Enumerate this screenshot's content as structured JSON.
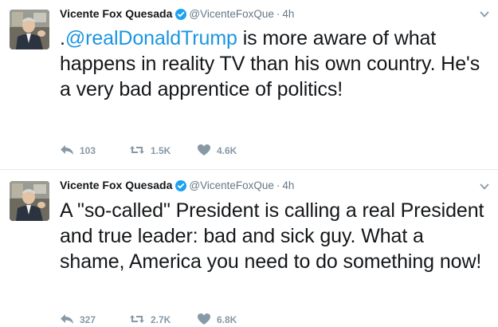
{
  "colors": {
    "link": "#1b95e0",
    "secondary_text": "#657786",
    "action_icon": "#8899a6",
    "verified_badge": "#1da1f2",
    "divider": "#e1e8ed"
  },
  "tweets": [
    {
      "author": {
        "display_name": "Vicente Fox Quesada",
        "verified": true,
        "handle": "@VicenteFoxQue",
        "avatar": "avatar-photo"
      },
      "separator": "·",
      "time": "4h",
      "text_prefix": ".",
      "mention": "@realDonaldTrump",
      "text_body": " is more aware of what happens in reality TV than his own country. He's a very bad apprentice of politics!",
      "actions": {
        "replies": "103",
        "retweets": "1.5K",
        "likes": "4.6K"
      },
      "icons": [
        "verified-badge-icon",
        "chevron-down-icon",
        "reply-icon",
        "retweet-icon",
        "heart-icon"
      ]
    },
    {
      "author": {
        "display_name": "Vicente Fox Quesada",
        "verified": true,
        "handle": "@VicenteFoxQue",
        "avatar": "avatar-photo"
      },
      "separator": "·",
      "time": "4h",
      "text_body": "A \"so-called\" President is calling a real President and true leader: bad and sick guy. What a shame, America you need to do something now!",
      "actions": {
        "replies": "327",
        "retweets": "2.7K",
        "likes": "6.8K"
      },
      "icons": [
        "verified-badge-icon",
        "chevron-down-icon",
        "reply-icon",
        "retweet-icon",
        "heart-icon"
      ]
    }
  ]
}
